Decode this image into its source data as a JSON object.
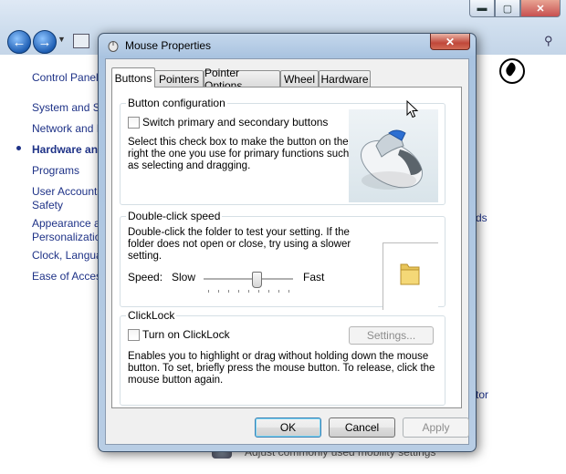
{
  "background_window": {
    "caption_minimize": "▬",
    "caption_maximize": "▢",
    "caption_close": "✕",
    "sidebar_items": [
      {
        "label": "Control Panel Home"
      },
      {
        "label": "System and Security"
      },
      {
        "label": "Network and Internet"
      },
      {
        "label": "Hardware and Sound"
      },
      {
        "label": "Programs"
      },
      {
        "label": "User Accounts and Family"
      },
      {
        "label": "Safety"
      },
      {
        "label": "Appearance and"
      },
      {
        "label": "Personalization"
      },
      {
        "label": "Clock, Language, and Region"
      },
      {
        "label": "Ease of Access"
      }
    ],
    "right_link_1": "ds",
    "right_link_2": "tor",
    "bottom_text": "Adjust commonly used mobility settings"
  },
  "dialog": {
    "title": "Mouse Properties",
    "close_glyph": "✕",
    "tabs": [
      {
        "label": "Buttons",
        "selected": true
      },
      {
        "label": "Pointers"
      },
      {
        "label": "Pointer Options"
      },
      {
        "label": "Wheel"
      },
      {
        "label": "Hardware"
      }
    ],
    "button_config": {
      "title": "Button configuration",
      "checkbox_label": "Switch primary and secondary buttons",
      "checked": false,
      "description": [
        "Select this check box to make the button on the",
        "right the one you use for primary functions such",
        "as selecting and dragging."
      ]
    },
    "double_click": {
      "title": "Double-click speed",
      "description": [
        "Double-click the folder to test your setting. If the",
        "folder does not open or close, try using a slower",
        "setting."
      ],
      "speed_label": "Speed:",
      "slow_label": "Slow",
      "fast_label": "Fast",
      "speed_value_fraction": 0.6
    },
    "clicklock": {
      "title": "ClickLock",
      "checkbox_label": "Turn on ClickLock",
      "checked": false,
      "settings_button": "Settings...",
      "description": [
        "Enables you to highlight or drag without holding down the mouse",
        "button. To set, briefly press the mouse button. To release, click the",
        "mouse button again."
      ]
    },
    "buttons": {
      "ok": "OK",
      "cancel": "Cancel",
      "apply": "Apply"
    }
  },
  "colors": {
    "link": "#1e3287",
    "title_bar": "#a9c3e0",
    "close_red": "#c0473a"
  }
}
